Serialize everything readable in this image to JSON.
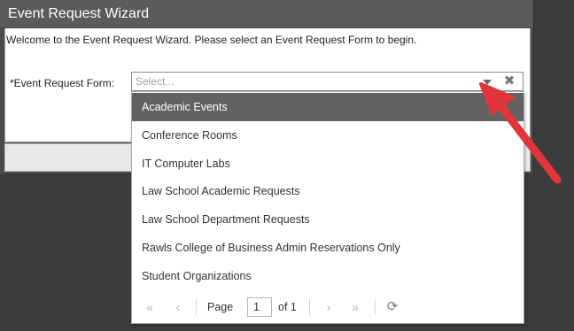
{
  "dialog": {
    "title": "Event Request Wizard",
    "welcome": "Welcome to the Event Request Wizard. Please select an Event Request Form to begin.",
    "form_label": "*Event Request Form:",
    "combo": {
      "placeholder": "Select...",
      "clear_glyph": "✖"
    },
    "options": [
      "Academic Events",
      "Conference Rooms",
      "IT Computer Labs",
      "Law School Academic Requests",
      "Law School Department Requests",
      "Rawls College of Business Admin Reservations Only",
      "Student Organizations"
    ],
    "selected_index": 0,
    "pager": {
      "first": "«",
      "prev": "‹",
      "page_label": "Page",
      "page_value": "1",
      "of_label": "of 1",
      "next": "›",
      "last": "»",
      "refresh": "⟳"
    }
  },
  "colors": {
    "annotation_arrow": "#e0363b",
    "selected_bg": "#626262"
  },
  "icons": [
    "chevron-down-icon",
    "clear-icon",
    "first-page-icon",
    "prev-page-icon",
    "next-page-icon",
    "last-page-icon",
    "refresh-icon"
  ]
}
